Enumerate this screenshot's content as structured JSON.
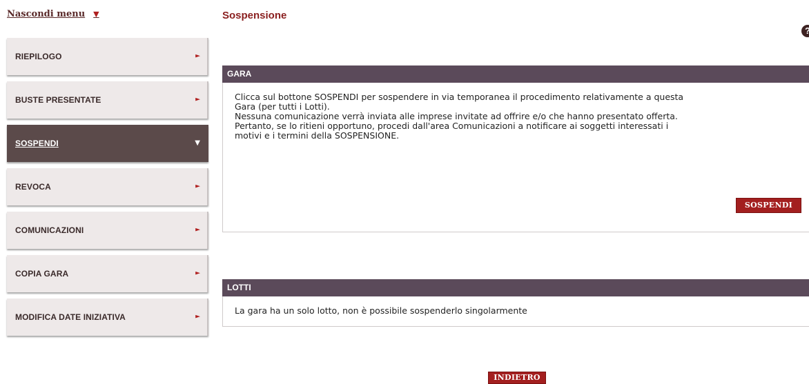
{
  "menu_toggle": {
    "label": "Nascondi menu",
    "arrow": "▼"
  },
  "sidebar": {
    "items": [
      {
        "label": "RIEPILOGO",
        "caret": "►",
        "active": false
      },
      {
        "label": "BUSTE PRESENTATE",
        "caret": "►",
        "active": false
      },
      {
        "label": "SOSPENDI",
        "caret": "▼",
        "active": true
      },
      {
        "label": "REVOCA",
        "caret": "►",
        "active": false
      },
      {
        "label": "COMUNICAZIONI",
        "caret": "►",
        "active": false
      },
      {
        "label": "COPIA GARA",
        "caret": "►",
        "active": false
      },
      {
        "label": "MODIFICA DATE INIZIATIVA",
        "caret": "►",
        "active": false
      }
    ]
  },
  "page": {
    "title": "Sospensione",
    "help": "?"
  },
  "gara": {
    "header": "GARA",
    "line1": "Clicca sul bottone SOSPENDI per sospendere in via temporanea il procedimento relativamente a questa",
    "line2": "Gara (per tutti i Lotti).",
    "line3": "Nessuna comunicazione verrà inviata alle imprese invitate ad offrire e/o che hanno presentato offerta.",
    "line4": "Pertanto, se lo ritieni opportuno, procedi dall'area Comunicazioni a notificare ai soggetti interessati i",
    "line5": "motivi e i termini della SOSPENSIONE.",
    "button": "SOSPENDI"
  },
  "lotti": {
    "header": "LOTTI",
    "text": "La gara ha un solo lotto, non è possibile sospenderlo singolarmente"
  },
  "footer": {
    "back_button": "INDIETRO"
  },
  "colors": {
    "accent": "#a31f1f",
    "title": "#8a1f1f",
    "panel_header": "#5b4a5a",
    "menu_active": "#5b4a4a",
    "menu_bg": "#eee9e9"
  }
}
